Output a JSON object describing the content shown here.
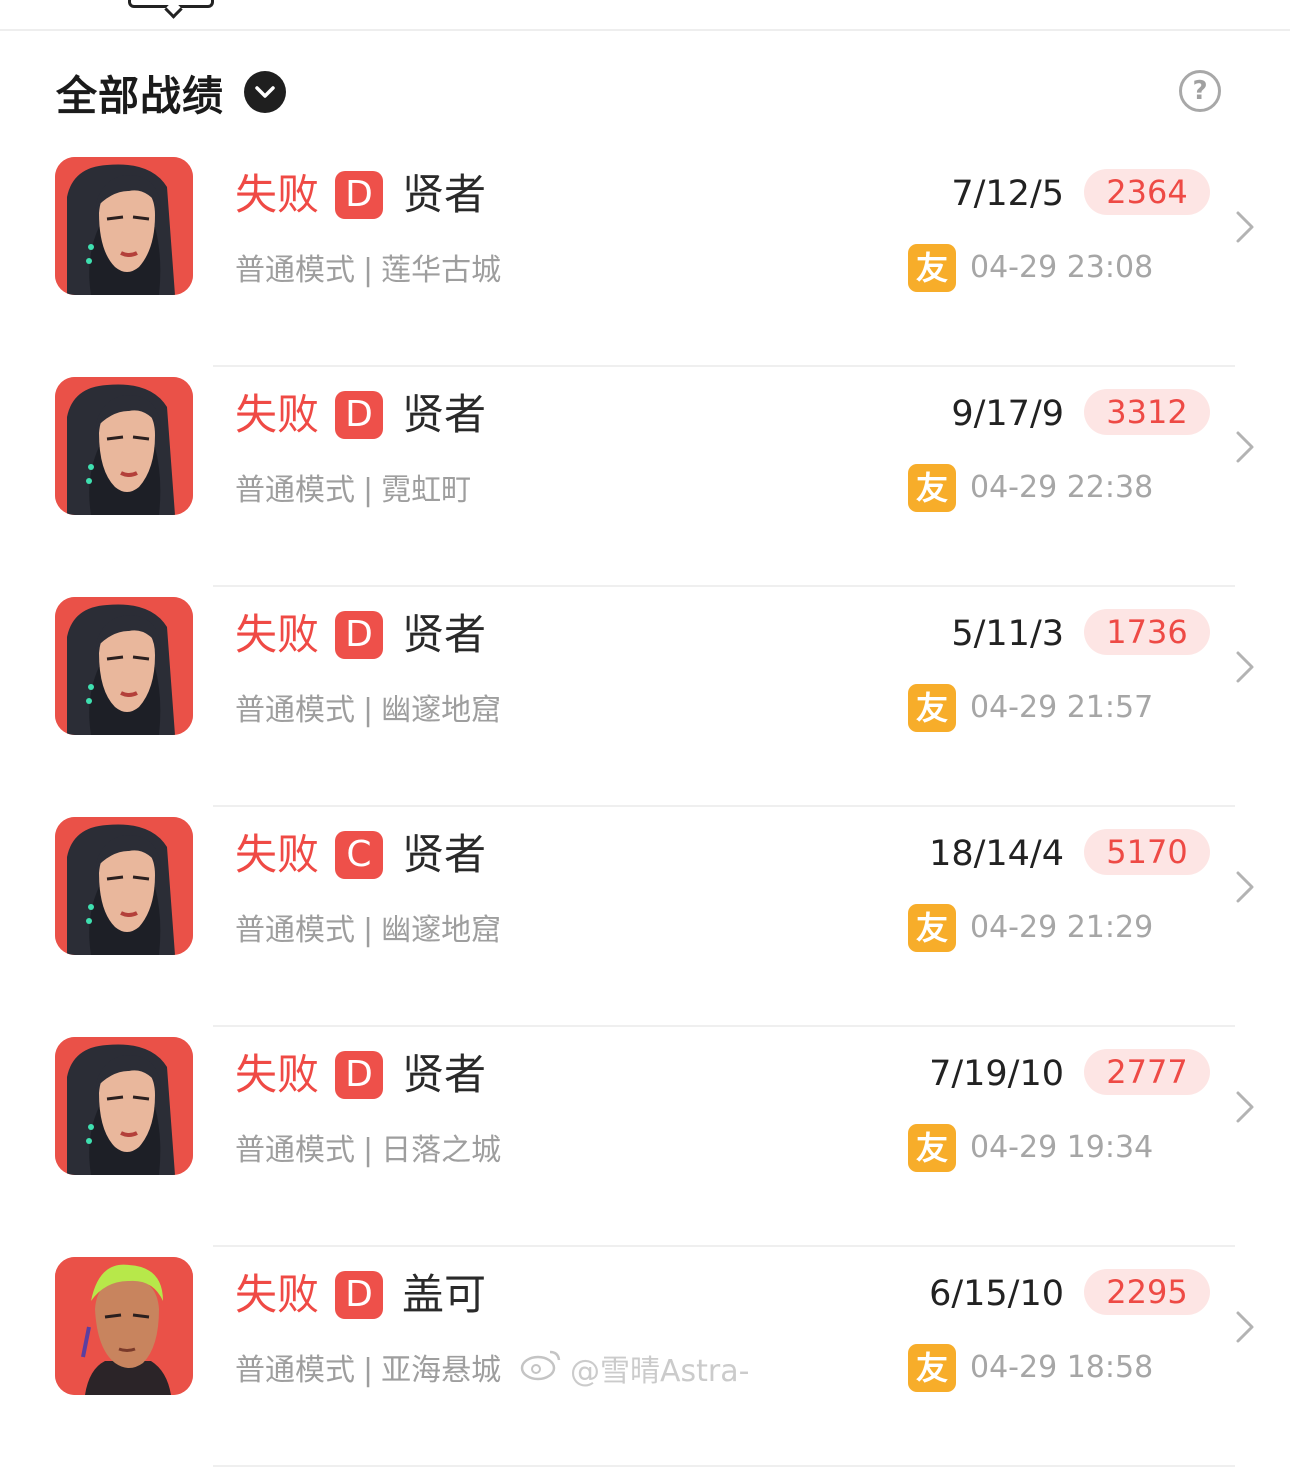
{
  "header": {
    "title": "全部战绩"
  },
  "records": [
    {
      "result": "失败",
      "grade": "D",
      "agent": "贤者",
      "mode": "普通模式",
      "map": "莲华古城",
      "kda": "7/12/5",
      "score": "2364",
      "friend_badge": "友",
      "time": "04-29 23:08",
      "avatar": "sage"
    },
    {
      "result": "失败",
      "grade": "D",
      "agent": "贤者",
      "mode": "普通模式",
      "map": "霓虹町",
      "kda": "9/17/9",
      "score": "3312",
      "friend_badge": "友",
      "time": "04-29 22:38",
      "avatar": "sage"
    },
    {
      "result": "失败",
      "grade": "D",
      "agent": "贤者",
      "mode": "普通模式",
      "map": "幽邃地窟",
      "kda": "5/11/3",
      "score": "1736",
      "friend_badge": "友",
      "time": "04-29 21:57",
      "avatar": "sage"
    },
    {
      "result": "失败",
      "grade": "C",
      "agent": "贤者",
      "mode": "普通模式",
      "map": "幽邃地窟",
      "kda": "18/14/4",
      "score": "5170",
      "friend_badge": "友",
      "time": "04-29 21:29",
      "avatar": "sage"
    },
    {
      "result": "失败",
      "grade": "D",
      "agent": "贤者",
      "mode": "普通模式",
      "map": "日落之城",
      "kda": "7/19/10",
      "score": "2777",
      "friend_badge": "友",
      "time": "04-29 19:34",
      "avatar": "sage"
    },
    {
      "result": "失败",
      "grade": "D",
      "agent": "盖可",
      "mode": "普通模式",
      "map": "亚海悬城",
      "kda": "6/15/10",
      "score": "2295",
      "friend_badge": "友",
      "time": "04-29 18:58",
      "avatar": "gekko"
    }
  ],
  "watermark": "@雪晴Astra-",
  "colors": {
    "loss_red": "#ef4a45",
    "grade_bg": "#ee504a",
    "score_bg": "#fde5e4",
    "friend_badge": "#f7ad2a",
    "avatar_bg": "#ea5148"
  },
  "icons": {
    "dropdown": "chevron-down-icon",
    "help": "question-circle-icon",
    "row_arrow": "chevron-right-icon",
    "watermark": "weibo-icon"
  }
}
